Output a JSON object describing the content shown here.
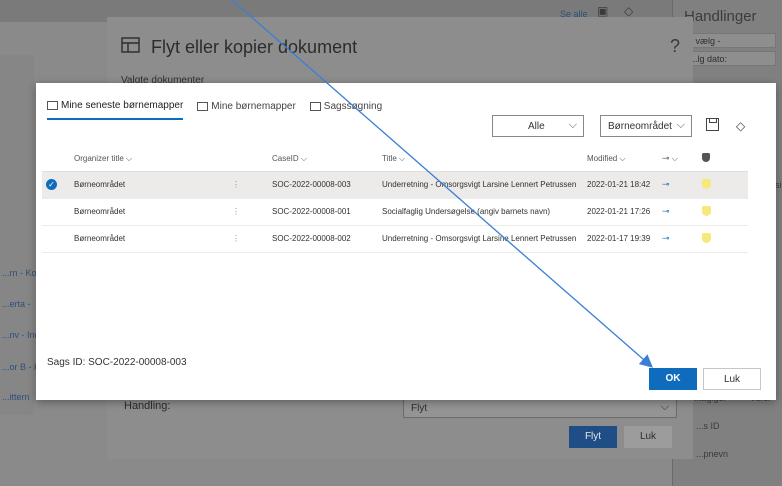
{
  "background": {
    "see_all": "Se alle",
    "right_panel_title": "Handlinger",
    "right_row1": "- vælg -",
    "right_row2": "...lg dato:",
    "right_side_text1": "rsi",
    "right_side_text2": "...agiger",
    "right_side_text3": "Versi",
    "right_side_text4": "...s ID",
    "right_side_text5": "...pnevn",
    "left_items": [
      "...rn - Ko",
      "...erta - ",
      "...nv - Ind",
      "...or B - K",
      "...ittern"
    ]
  },
  "outer_dialog": {
    "title": "Flyt eller kopier dokument",
    "help": "?",
    "selected_label": "Valgte dokumenter",
    "handling_label": "Handling:",
    "handling_value": "Flyt",
    "flyt_button": "Flyt",
    "luk_button": "Luk"
  },
  "modal": {
    "tabs": [
      {
        "label": "Mine seneste børnemapper",
        "active": true
      },
      {
        "label": "Mine børnemapper",
        "active": false
      },
      {
        "label": "Sagssøgning",
        "active": false
      }
    ],
    "filter_status": "Alle",
    "filter_area": "Børneområdet",
    "columns": {
      "organizer": "Organizer title",
      "caseid": "CaseID",
      "title": "Title",
      "modified": "Modified"
    },
    "rows": [
      {
        "organizer": "Børneområdet",
        "caseid": "SOC-2022-00008-003",
        "title": "Underretning - Omsorgsvigt Larsine Lennert Petrussen",
        "modified": "2022-01-21 18:42",
        "selected": true
      },
      {
        "organizer": "Børneområdet",
        "caseid": "SOC-2022-00008-001",
        "title": "Socialfaglig Undersøgelse (angiv barnets navn)",
        "modified": "2022-01-21 17:26",
        "selected": false
      },
      {
        "organizer": "Børneområdet",
        "caseid": "SOC-2022-00008-002",
        "title": "Underretning - Omsorgsvigt Larsine Lennert Petrussen",
        "modified": "2022-01-17 19:39",
        "selected": false
      }
    ],
    "sags_id": "Sags ID: SOC-2022-00008-003",
    "ok_button": "OK",
    "luk_button": "Luk"
  }
}
